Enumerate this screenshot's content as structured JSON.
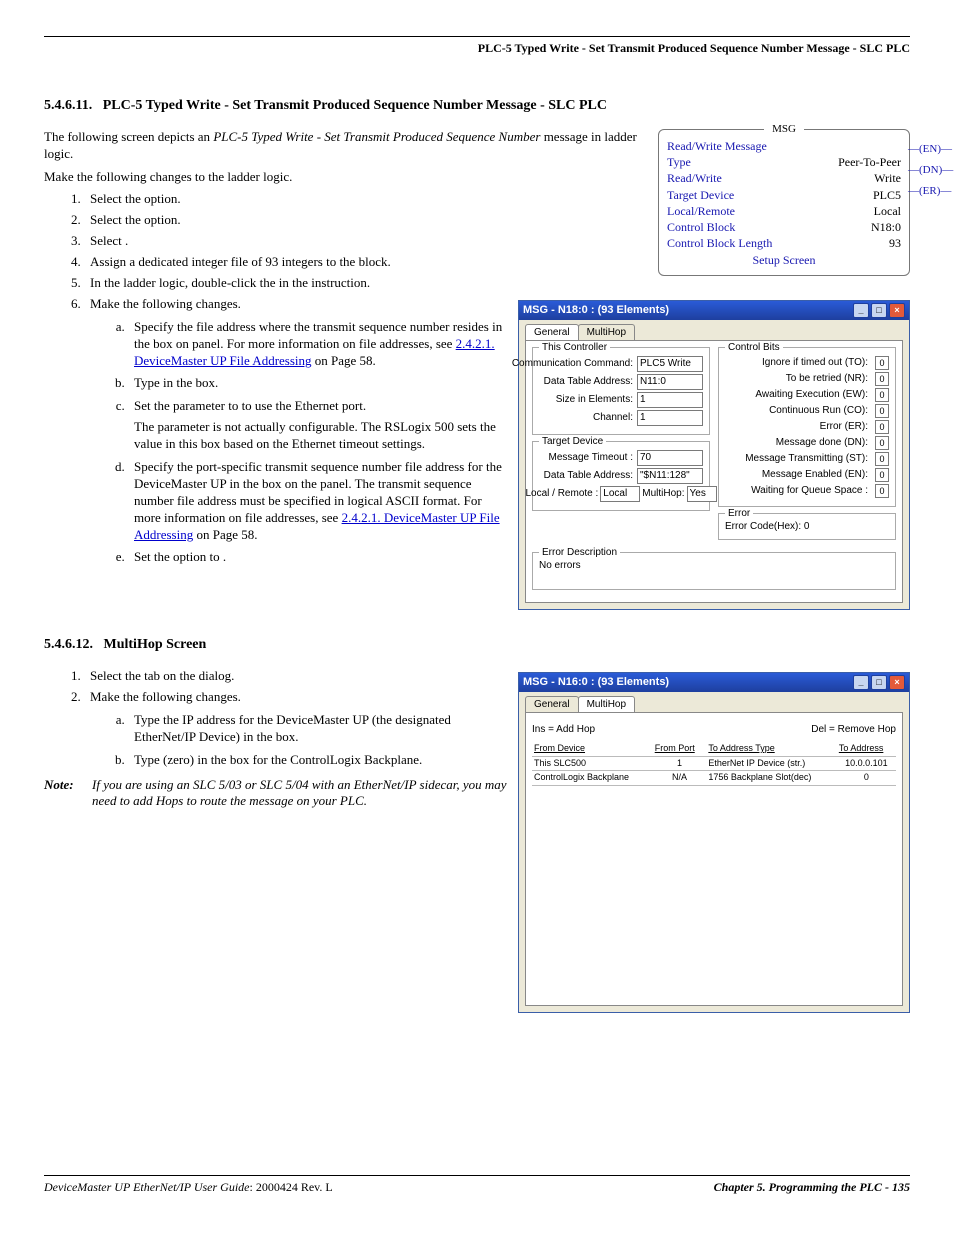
{
  "header": {
    "running_head": "PLC-5 Typed Write - Set Transmit Produced Sequence Number Message - SLC PLC"
  },
  "sec1": {
    "num": "5.4.6.11.",
    "title": "PLC-5 Typed Write - Set Transmit Produced Sequence Number Message - SLC PLC",
    "intro1_a": "The following screen depicts an ",
    "intro1_em": "PLC-5 Typed Write - Set Transmit Produced Sequence Number",
    "intro1_b": " message in ladder logic.",
    "intro2": "Make the following changes to the ladder logic.",
    "li1": "Select the            option.",
    "li2": "Select the            option.",
    "li3": "Select         .",
    "li4": "Assign a dedicated integer file of 93 integers to the               block.",
    "li5": "In the ladder logic, double-click the                                                      in the            instruction.",
    "li6": "Make the following changes.",
    "a_a1": "Specify the file address where the transmit sequence number resides in the                          box on                      panel. For more information on file addresses, see ",
    "a_a_link": "2.4.2.1. DeviceMaster UP File Addressing",
    "a_a2": " on Page 58.",
    "a_b": "Type     in the                               box.",
    "a_c1": "Set the                      parameter to     to use the Ethernet port.",
    "a_c2": "The                               parameter is not actually configurable. The RSLogix 500 sets the value in this box based on the Ethernet timeout settings.",
    "a_d1": "Specify the port-specific transmit sequence number file address for the DeviceMaster UP in the                               box on the                          panel. The transmit sequence number file address must be specified in logical ASCII format. For more information on file addresses, see ",
    "a_d_link": "2.4.2.1. DeviceMaster UP File Addressing",
    "a_d2": " on Page 58.",
    "a_e": "Set the                option to         ."
  },
  "ladder": {
    "cap": "MSG",
    "l1": "Read/Write Message",
    "l2": "Type",
    "v2": "Peer-To-Peer",
    "l3": "Read/Write",
    "v3": "Write",
    "l4": "Target Device",
    "v4": "PLC5",
    "l5": "Local/Remote",
    "v5": "Local",
    "l6": "Control Block",
    "v6": "N18:0",
    "l7": "Control Block Length",
    "v7": "93",
    "setup": "Setup Screen",
    "coil1": "EN",
    "coil2": "DN",
    "coil3": "ER"
  },
  "win1": {
    "title": "MSG - N18:0 : (93 Elements)",
    "tab_general": "General",
    "tab_multihop": "MultiHop",
    "grp_this": "This Controller",
    "cc_l": "Communication Command:",
    "cc_v": "PLC5 Write",
    "dta_l": "Data Table Address:",
    "dta_v": "N11:0",
    "sie_l": "Size in Elements:",
    "sie_v": "1",
    "ch_l": "Channel:",
    "ch_v": "1",
    "grp_target": "Target Device",
    "mt_l": "Message Timeout :",
    "mt_v": "70",
    "dta2_l": "Data Table Address:",
    "dta2_v": "\"$N11:128\"",
    "lr_l": "Local / Remote :",
    "lr_v": "Local",
    "mh_l": "MultiHop:",
    "mh_v": "Yes",
    "grp_bits": "Control Bits",
    "b1": "Ignore if timed out (TO):",
    "b2": "To be retried (NR):",
    "b3": "Awaiting Execution (EW):",
    "b4": "Continuous Run (CO):",
    "b5": "Error (ER):",
    "b6": "Message done (DN):",
    "b7": "Message Transmitting (ST):",
    "b8": "Message Enabled (EN):",
    "b9": "Waiting for Queue Space :",
    "bval": "0",
    "grp_err": "Error",
    "err_txt": "Error Code(Hex): 0",
    "grp_desc": "Error Description",
    "desc_txt": "No errors"
  },
  "sec2": {
    "num": "5.4.6.12.",
    "title": "MultiHop Screen",
    "li1": "Select the                  tab on the               dialog.",
    "li2": "Make the following changes.",
    "a_a": "Type the IP address for the DeviceMaster UP (the designated EtherNet/IP Device) in the                    box.",
    "a_b": "Type     (zero) in the                    box for the ControlLogix Backplane.",
    "note_label": "Note:",
    "note_body": "If you are using an SLC 5/03 or SLC 5/04 with an EtherNet/IP sidecar, you may need to add Hops to route the message on your PLC."
  },
  "win2": {
    "title": "MSG - N16:0 : (93 Elements)",
    "tab_general": "General",
    "tab_multihop": "MultiHop",
    "add": "Ins = Add Hop",
    "del": "Del = Remove Hop",
    "h1": "From Device",
    "h2": "From Port",
    "h3": "To Address Type",
    "h4": "To Address",
    "r1c1": "This SLC500",
    "r1c2": "1",
    "r1c3": "EtherNet IP Device (str.)",
    "r1c4": "10.0.0.101",
    "r2c1": "ControlLogix Backplane",
    "r2c2": "N/A",
    "r2c3": "1756 Backplane Slot(dec)",
    "r2c4": "0"
  },
  "footer": {
    "left_em": "DeviceMaster UP EtherNet/IP User Guide",
    "left_rest": ": 2000424 Rev. L",
    "right": "Chapter 5. Programming the PLC - 135"
  }
}
